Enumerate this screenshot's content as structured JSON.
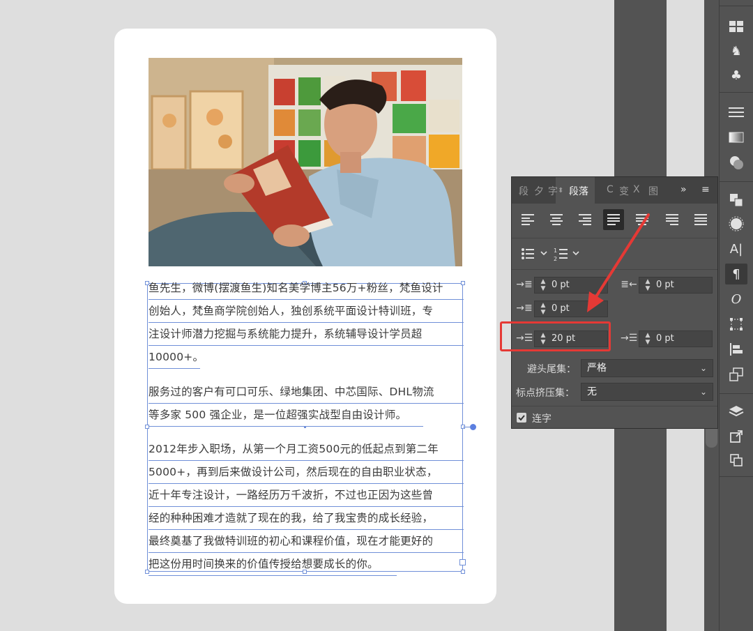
{
  "canvas": {
    "paragraphs": [
      {
        "lines": [
          "鱼先生，微博(摆渡鱼生)知名美学博主56万+粉丝，梵鱼设计",
          "创始人，梵鱼商学院创始人，独创系统平面设计特训班，专",
          "注设计师潜力挖掘与系统能力提升，系统辅导设计学员超",
          "10000+。"
        ]
      },
      {
        "lines": [
          "服务过的客户有可口可乐、绿地集团、中芯国际、DHL物流",
          "等多家 500 强企业，是一位超强实战型自由设计师。"
        ]
      },
      {
        "lines": [
          "2012年步入职场，从第一个月工资500元的低起点到第二年",
          "5000+，再到后来做设计公司，然后现在的自由职业状态，",
          "近十年专注设计，一路经历万千波折，不过也正因为这些曾",
          "经的种种困难才造就了现在的我，给了我宝贵的成长经验，",
          "最终奠基了我做特训班的初心和课程价值，现在才能更好的",
          "把这份用时间换来的价值传授给想要成长的你。"
        ]
      }
    ]
  },
  "panel": {
    "tabs": [
      "段",
      "夕",
      "字",
      "段落",
      "C",
      "变",
      "X",
      "图"
    ],
    "active_tab": "段落",
    "indent_left": {
      "value": "0",
      "unit": "pt"
    },
    "indent_right": {
      "value": "0",
      "unit": "pt"
    },
    "indent_first": {
      "value": "0",
      "unit": "pt"
    },
    "space_before": {
      "value": "20",
      "unit": "pt"
    },
    "space_after": {
      "value": "0",
      "unit": "pt"
    },
    "kinsoku_label": "避头尾集：",
    "kinsoku_value": "严格",
    "mojikumi_label": "标点挤压集：",
    "mojikumi_value": "无",
    "hyphenate_label": "连字",
    "hyphenate_checked": true
  },
  "colors": {
    "highlight": "#e53935",
    "panel_bg": "#535353",
    "frame": "#6f8fd8"
  },
  "icons": [
    "align-left-icon",
    "align-center-icon",
    "align-right-icon",
    "justify-last-left-icon",
    "justify-last-center-icon",
    "justify-last-right-icon",
    "justify-all-icon",
    "bullets-icon",
    "numbering-icon"
  ]
}
